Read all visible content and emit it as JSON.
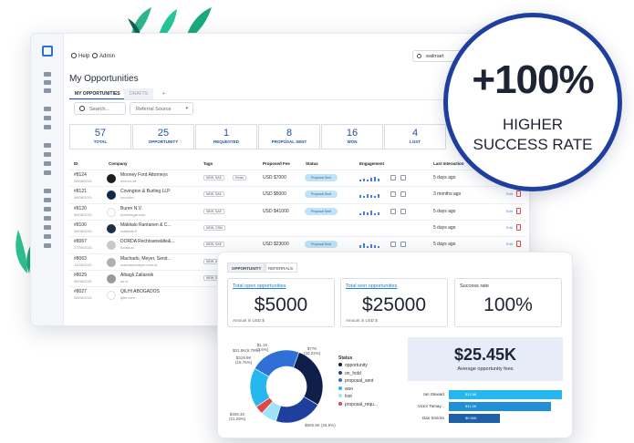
{
  "window": {
    "help_label": "Help",
    "admin_label": "Admin",
    "search_value": "walmart",
    "title": "My Opportunities",
    "tabs": [
      {
        "label": "MY OPPORTUNITIES",
        "active": true
      },
      {
        "label": "DRAFTS",
        "active": false
      },
      {
        "label": "+",
        "active": false
      }
    ],
    "search_placeholder": "Search...",
    "source_filter": "Referral Source",
    "stats": [
      {
        "value": "57",
        "label": "TOTAL"
      },
      {
        "value": "25",
        "label": "OPPORTUNITY"
      },
      {
        "value": "1",
        "label": "REQUESTED"
      },
      {
        "value": "8",
        "label": "PROPOSAL SENT"
      },
      {
        "value": "16",
        "label": "WON"
      },
      {
        "value": "4",
        "label": "LOST"
      }
    ],
    "columns": [
      "ID",
      "Company",
      "Tags",
      "Proposed Fee",
      "Status",
      "Engagement",
      "Last Interaction"
    ],
    "rows": [
      {
        "id": "#8124",
        "date": "08/08/2021",
        "company": "Mooney Ford Attorneys",
        "sub": "mfa.co.za",
        "tags": [
          "NEW, SAE",
          "Email"
        ],
        "fee": "USD $7000",
        "status": "Proposal Sent",
        "last": "5 days ago",
        "edit": "Edit"
      },
      {
        "id": "#8121",
        "date": "08/08/2021",
        "company": "Covington & Burling LLP",
        "sub": "cov.com",
        "tags": [
          "NEW, SAE"
        ],
        "fee": "USD $5000",
        "status": "Proposal Sent",
        "last": "3 months ago",
        "edit": "Edit"
      },
      {
        "id": "#8120",
        "date": "08/08/2021",
        "company": "Buren N.V.",
        "sub": "burenlegal.com",
        "tags": [
          "NEW, SAE"
        ],
        "fee": "USD $41000",
        "status": "Proposal Sent",
        "last": "5 days ago",
        "edit": "Edit"
      },
      {
        "id": "#8106",
        "date": "08/08/2021",
        "company": "Mäkitalo Rantanen & C...",
        "sub": "makitalo.fi",
        "tags": [
          "NEW, CRM"
        ],
        "fee": "",
        "status": "",
        "last": "5 days ago",
        "edit": "Edit"
      },
      {
        "id": "#8067",
        "date": "27/06/2021",
        "company": "DORDA Rechtsanwälte&...",
        "sub": "dorda.at",
        "tags": [
          "NEW, SAE"
        ],
        "fee": "USD $23000",
        "status": "Proposal Sent",
        "last": "5 days ago",
        "edit": "Edit"
      },
      {
        "id": "#8063",
        "date": "14/06/2021",
        "company": "Machado, Meyer, Send...",
        "sub": "machadomeyer.com.br",
        "tags": [
          "NEW, SAE"
        ],
        "fee": "",
        "status": "",
        "last": "",
        "edit": ""
      },
      {
        "id": "#8029",
        "date": "08/06/2021",
        "company": "Albagli Zaliasnik",
        "sub": "az.cl",
        "tags": [
          "NEW, SAE"
        ],
        "fee": "",
        "status": "",
        "last": "",
        "edit": ""
      },
      {
        "id": "#8027",
        "date": "08/06/2021",
        "company": "QILHI ABOGADOS",
        "sub": "qilhi.com",
        "tags": [],
        "fee": "",
        "status": "",
        "last": "",
        "edit": ""
      }
    ]
  },
  "badge": {
    "headline": "+100%",
    "line1": "HIGHER",
    "line2": "SUCCESS RATE"
  },
  "panel": {
    "tabs": [
      "OPPORTUNITY",
      "REFERRALS"
    ],
    "kpis": [
      {
        "title": "Total open opportunities",
        "value": "$5000",
        "unit": "Amount in USD $",
        "link": true
      },
      {
        "title": "Total won opportunities",
        "value": "$25000",
        "unit": "Amount in USD $",
        "link": true
      },
      {
        "title": "Success rate",
        "value": "100%",
        "unit": "",
        "link": false
      }
    ],
    "donut_labels": [
      {
        "text": "$1.1K",
        "sub": "(3.6%)"
      },
      {
        "text": "$31.5K",
        "sub": "(6.79%)"
      },
      {
        "text": "$77K",
        "sub": "(20.22%)"
      },
      {
        "text": "$319.9K",
        "sub": "(16.76%)"
      },
      {
        "text": "$406.4K",
        "sub": "(21.29%)"
      },
      {
        "text": "$505.9K (26.5%)",
        "sub": ""
      }
    ],
    "legend_title": "Status",
    "legend": [
      {
        "label": "opportunity",
        "color": "#0d1f4a"
      },
      {
        "label": "on_hold",
        "color": "#1f3f9e"
      },
      {
        "label": "proposal_sent",
        "color": "#2f6fd6"
      },
      {
        "label": "won",
        "color": "#27b7ef"
      },
      {
        "label": "lost",
        "color": "#9fe3f6"
      },
      {
        "label": "proposal_requ...",
        "color": "#e04848"
      }
    ],
    "fees_value": "$25.45K",
    "fees_label": "Average opportunity fees",
    "bars": [
      {
        "name": "Ian Stewart",
        "value_label": "$12.5K",
        "color": "#27b7ef"
      },
      {
        "name": "Victor Tamay...",
        "value_label": "$11.5K",
        "color": "#1f8fd6"
      },
      {
        "name": "Dan Smicks",
        "value_label": "$0.50K",
        "color": "#1f5fa8"
      }
    ]
  }
}
